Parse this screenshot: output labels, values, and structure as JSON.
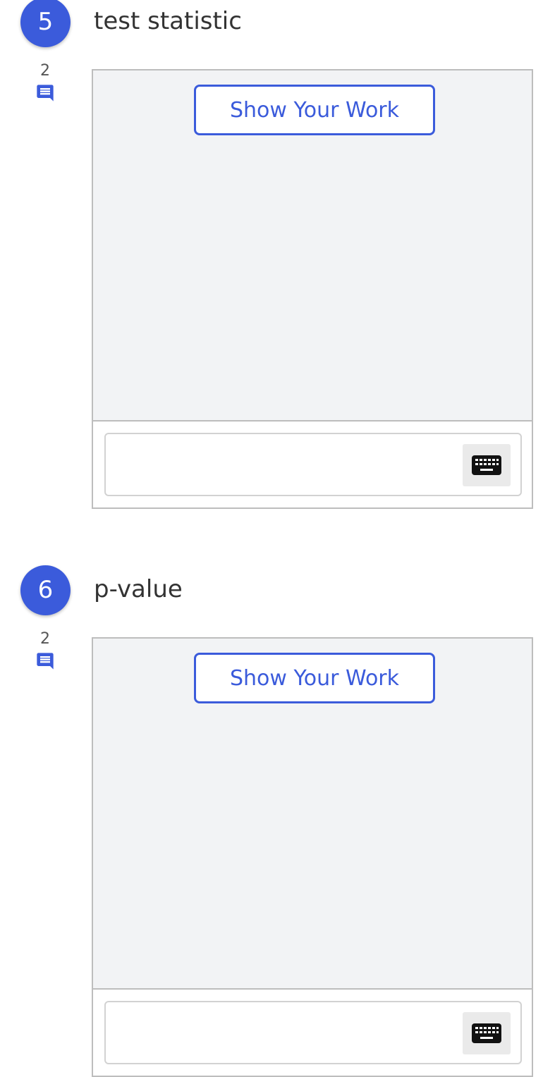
{
  "colors": {
    "accent": "#3b5bdb",
    "panel_background": "#f2f3f5",
    "border": "#bdbdbd",
    "text": "#333333"
  },
  "questions": [
    {
      "number": "5",
      "title": "test statistic",
      "comment_count": "2",
      "comment_icon": "comment-icon",
      "show_work_label": "Show Your Work",
      "keyboard_icon": "keyboard-icon",
      "answer_value": ""
    },
    {
      "number": "6",
      "title": "p-value",
      "comment_count": "2",
      "comment_icon": "comment-icon",
      "show_work_label": "Show Your Work",
      "keyboard_icon": "keyboard-icon",
      "answer_value": ""
    }
  ]
}
